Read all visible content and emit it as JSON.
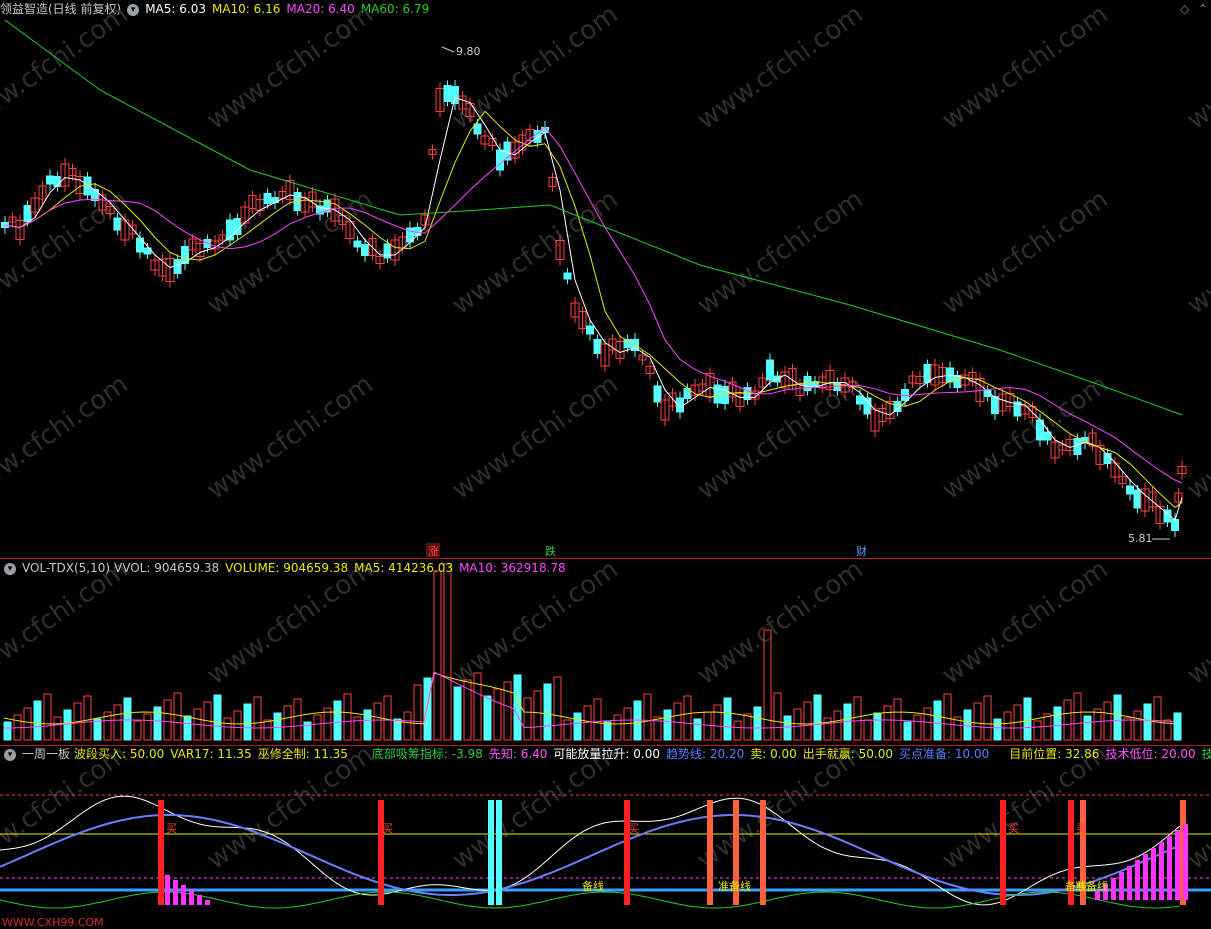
{
  "main": {
    "title": "领益智造(日线 前复权)",
    "ma5": "MA5: 6.03",
    "ma10": "MA10: 6.16",
    "ma20": "MA20: 6.40",
    "ma60": "MA60: 6.79",
    "high_label": "9.80",
    "low_label": "5.81",
    "markers": [
      "涨",
      "跌",
      "财"
    ]
  },
  "volume": {
    "name": "VOL-TDX(5,10)",
    "vvol": "VVOL: 904659.38",
    "volume": "VOLUME: 904659.38",
    "ma5": "MA5: 414236.03",
    "ma10": "MA10: 362918.78"
  },
  "indicator": {
    "name": "一周一板",
    "items": [
      {
        "text": "波段买入: 50.00",
        "color": "#e8e800"
      },
      {
        "text": "VAR17: 11.35",
        "color": "#e8e800"
      },
      {
        "text": "巫修全制: 11.35",
        "color": "#e8e800"
      },
      {
        "text": "底部吸筹指标: -3.98",
        "color": "#2ecc40"
      },
      {
        "text": "先知: 6.40",
        "color": "#ff55ff"
      },
      {
        "text": "可能放量拉升: 0.00",
        "color": "#ffffff"
      },
      {
        "text": "趋势线: 20.20",
        "color": "#5b7cff"
      },
      {
        "text": "卖: 0.00",
        "color": "#e8e800"
      },
      {
        "text": "出手就赢: 50.00",
        "color": "#e8e800"
      },
      {
        "text": "买点准备: 10.00",
        "color": "#5b7cff"
      },
      {
        "text": "目前位置: 32.86",
        "color": "#e8e800"
      },
      {
        "text": "技术低位: 20.00",
        "color": "#ff55ff"
      },
      {
        "text": "技术中位",
        "color": "#2ecc40"
      }
    ],
    "annotations": [
      "买",
      "买",
      "买",
      "买",
      "买",
      "备线",
      "备线",
      "准备线",
      "准备线"
    ],
    "watermark": "WWW.CXH99.COM"
  },
  "site_watermark": "www.cfchi.com",
  "colors": {
    "up": "#ff4040",
    "down": "#54ffff",
    "ma5": "#ffffff",
    "ma10": "#e8e800",
    "ma20": "#ff44ff",
    "ma60": "#22cc22"
  }
}
